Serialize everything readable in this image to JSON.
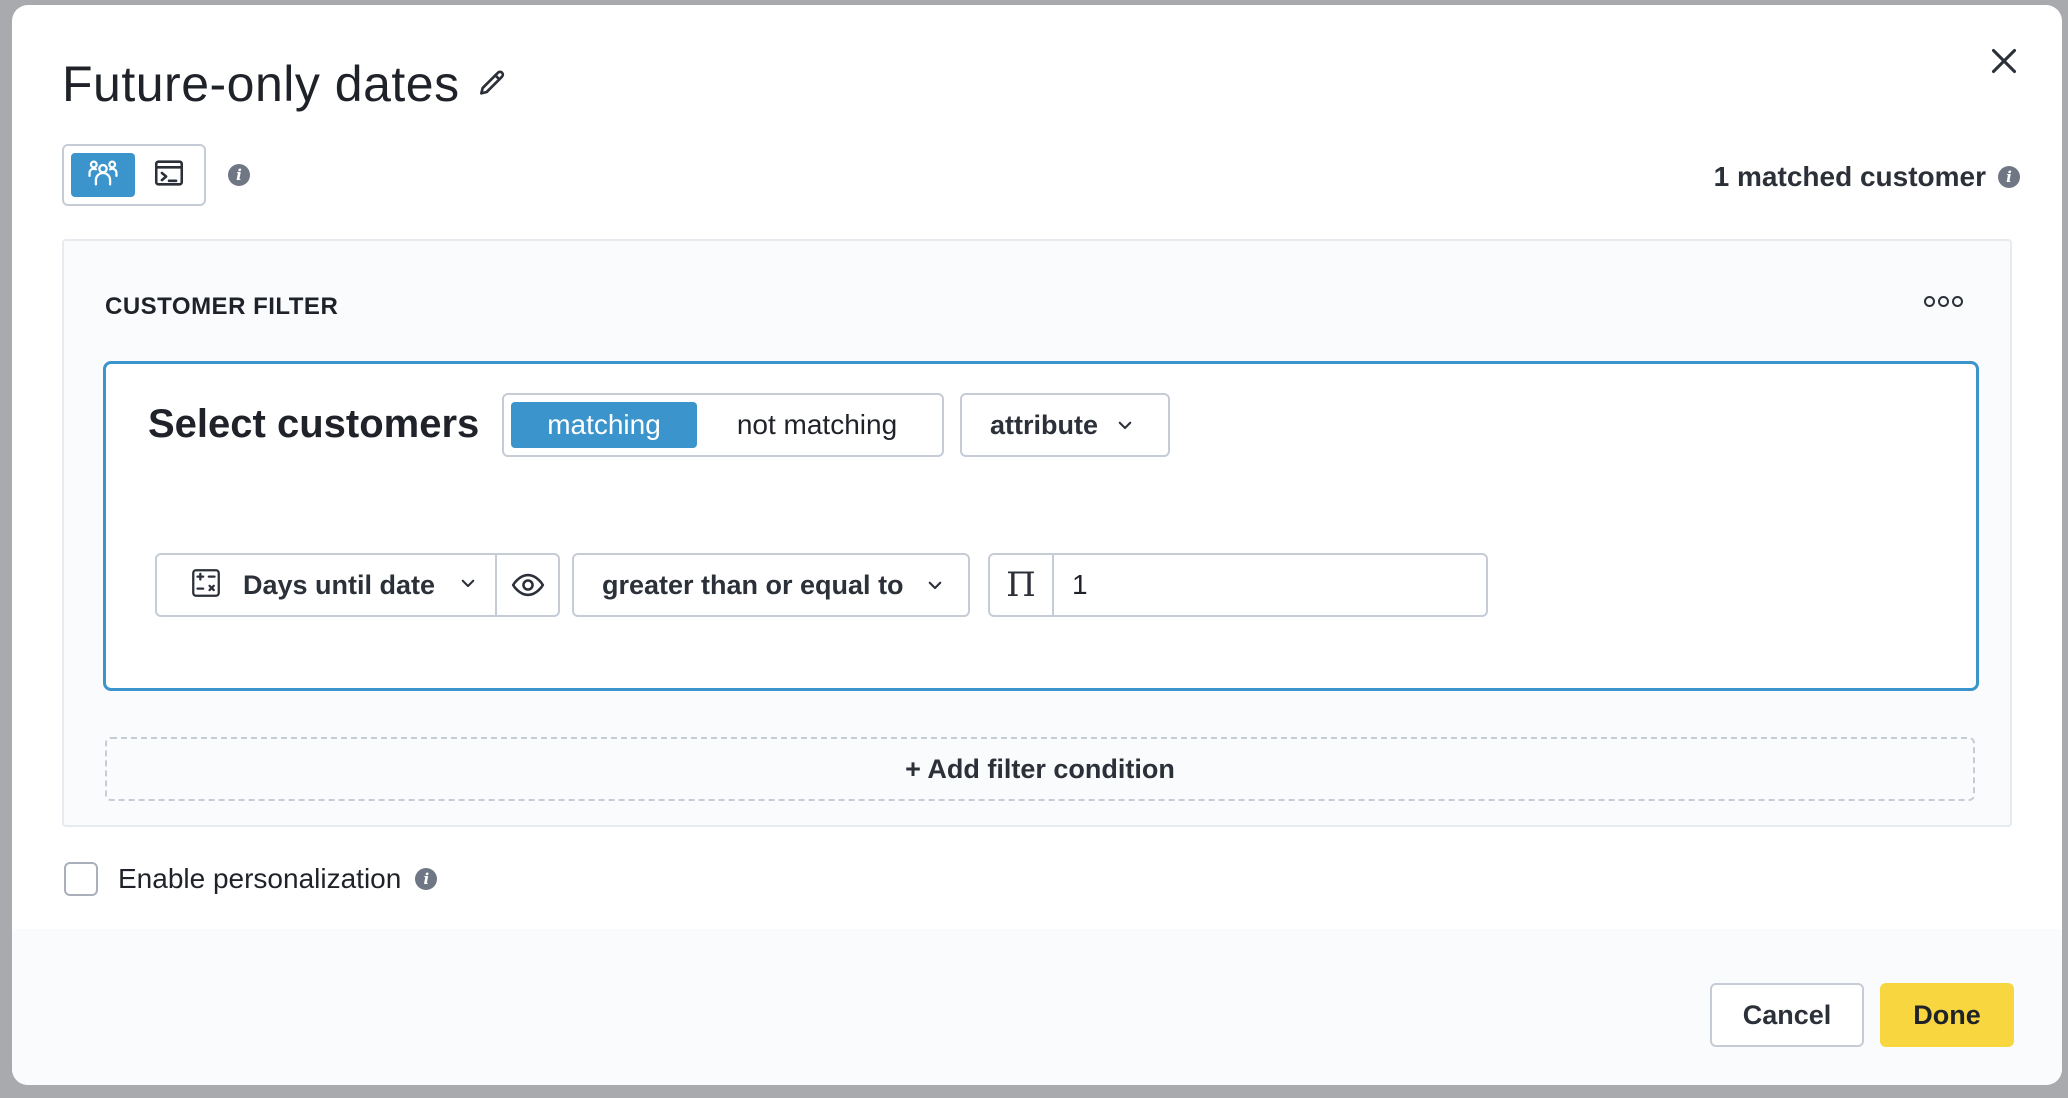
{
  "modal": {
    "title": "Future-only dates",
    "matched_count_label": "1 matched customer"
  },
  "filter": {
    "heading": "CUSTOMER FILTER",
    "select_label": "Select customers",
    "match_options": [
      "matching",
      "not matching"
    ],
    "selected_match": "matching",
    "condition_type": "attribute",
    "condition": {
      "field": "Days until date",
      "operator": "greater than or equal to",
      "value_type_symbol": "Π",
      "value": "1"
    },
    "add_condition_label": "+ Add filter condition"
  },
  "personalization": {
    "label": "Enable personalization",
    "checked": false
  },
  "footer": {
    "cancel_label": "Cancel",
    "done_label": "Done"
  },
  "colors": {
    "accent": "#3b95cc",
    "primary_button": "#f7d640",
    "border": "#c6ccd6",
    "text": "#1f2329"
  },
  "icons": {
    "edit": "pencil-icon",
    "close": "close-icon",
    "audience_view": "people-group-icon",
    "code_view": "terminal-icon",
    "info": "info-icon",
    "more": "more-horizontal-icon",
    "field": "calculator-icon",
    "visibility": "eye-icon",
    "dropdown": "chevron-down-icon"
  }
}
